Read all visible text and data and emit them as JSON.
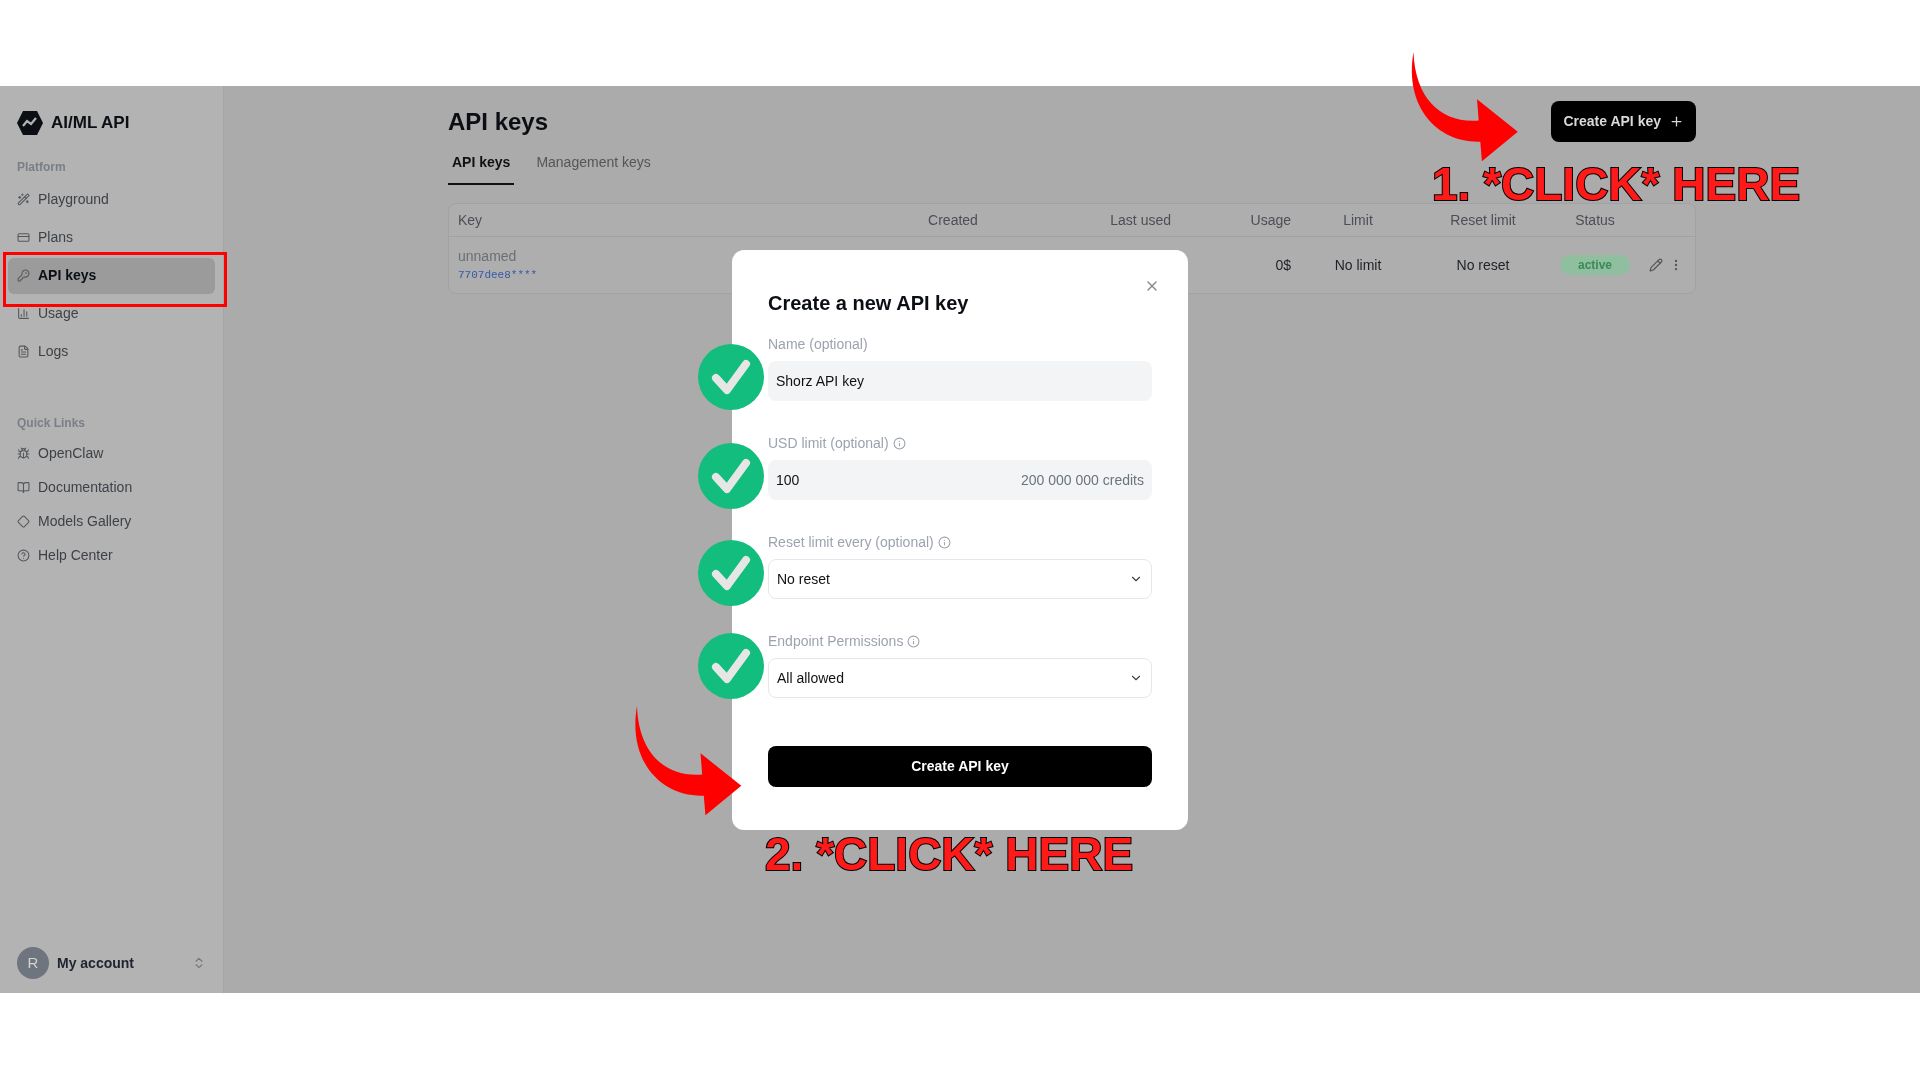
{
  "sidebar": {
    "logo": "AI/ML API",
    "sections": [
      {
        "title": "Platform",
        "items": [
          {
            "label": "Playground",
            "selected": false
          },
          {
            "label": "Plans",
            "selected": false
          },
          {
            "label": "API keys",
            "selected": true
          },
          {
            "label": "Usage",
            "selected": false
          },
          {
            "label": "Logs",
            "selected": false
          }
        ]
      },
      {
        "title": "Quick Links",
        "items": [
          {
            "label": "OpenClaw",
            "selected": false
          },
          {
            "label": "Documentation",
            "selected": false
          },
          {
            "label": "Models Gallery",
            "selected": false
          },
          {
            "label": "Help Center",
            "selected": false
          }
        ]
      }
    ],
    "account": {
      "initial": "R",
      "label": "My account"
    }
  },
  "page": {
    "title": "API keys",
    "create_button": "Create API key",
    "tabs": [
      {
        "label": "API keys",
        "selected": true
      },
      {
        "label": "Management keys",
        "selected": false
      }
    ]
  },
  "table": {
    "columns": [
      "Key",
      "Created",
      "Last used",
      "Usage",
      "Limit",
      "Reset limit",
      "Status"
    ],
    "rows": [
      {
        "name": "unnamed",
        "key": "7707dee8****",
        "usage": "0$",
        "limit": "No limit",
        "reset_limit": "No reset",
        "status": "active"
      }
    ]
  },
  "dialog": {
    "title": "Create a new API key",
    "fields": [
      {
        "kind": "text",
        "label": "Name (optional)",
        "value": "Shorz API key",
        "info": false
      },
      {
        "kind": "number",
        "label": "USD limit (optional)",
        "value": "100",
        "suffix": "200 000 000 credits",
        "info": true
      },
      {
        "kind": "select",
        "label": "Reset limit every (optional)",
        "value": "No reset",
        "info": true
      },
      {
        "kind": "select",
        "label": "Endpoint Permissions",
        "value": "All allowed",
        "info": true
      }
    ],
    "submit": "Create API key"
  },
  "annotations": [
    {
      "text": "1. *CLICK* HERE"
    },
    {
      "text": "2. *CLICK* HERE"
    }
  ]
}
